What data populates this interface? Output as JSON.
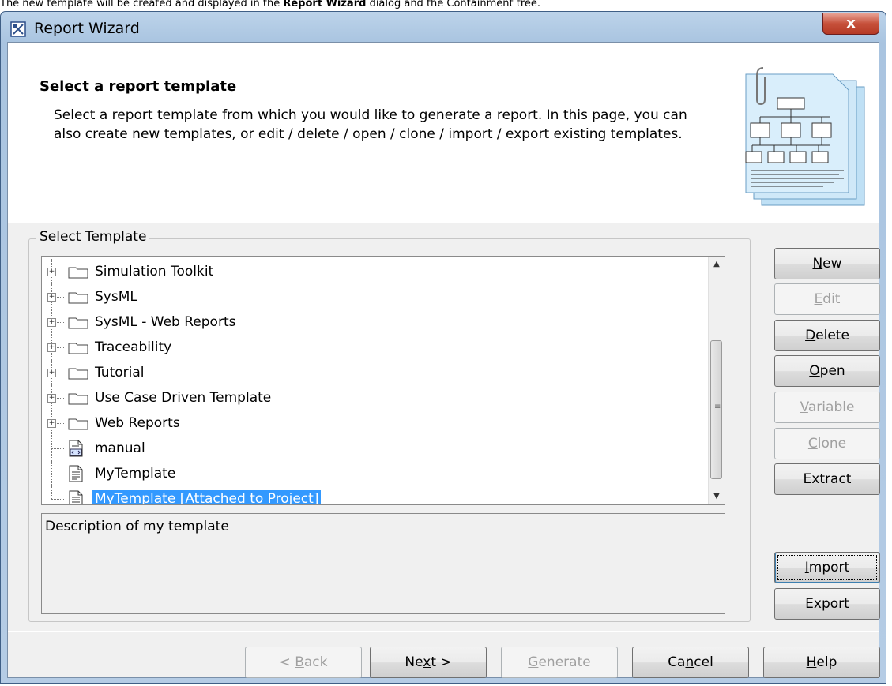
{
  "caption": {
    "pre": "The new template will be created and displayed in the ",
    "bold1": "Report Wizard",
    "mid": " dialog and the Containment tree."
  },
  "window": {
    "title": "Report Wizard",
    "close_label": "x"
  },
  "header": {
    "title": "Select a report template",
    "description": "Select a report template from which you would like to generate a report. In this page, you can also create new templates, or edit / delete / open / clone / import / export existing templates."
  },
  "template_group": {
    "label": "Select Template",
    "items": [
      {
        "label": "Simulation Toolkit",
        "type": "folder"
      },
      {
        "label": "SysML",
        "type": "folder"
      },
      {
        "label": "SysML - Web Reports",
        "type": "folder"
      },
      {
        "label": "Traceability",
        "type": "folder"
      },
      {
        "label": "Tutorial",
        "type": "folder"
      },
      {
        "label": "Use Case Driven Template",
        "type": "folder"
      },
      {
        "label": "Web Reports",
        "type": "folder"
      },
      {
        "label": "manual",
        "type": "xml-file"
      },
      {
        "label": "MyTemplate",
        "type": "file"
      },
      {
        "label": "MyTemplate [Attached to Project]",
        "type": "file",
        "selected": true
      }
    ],
    "description": "Description of my template"
  },
  "side_buttons": {
    "new": {
      "pre": "",
      "key": "N",
      "post": "ew"
    },
    "edit": {
      "pre": "",
      "key": "E",
      "post": "dit"
    },
    "delete": {
      "pre": "",
      "key": "D",
      "post": "elete"
    },
    "open": {
      "pre": "",
      "key": "O",
      "post": "pen"
    },
    "variable": {
      "pre": "",
      "key": "V",
      "post": "ariable"
    },
    "clone": {
      "pre": "",
      "key": "C",
      "post": "lone"
    },
    "extract": {
      "pre": "Extract",
      "key": "",
      "post": ""
    },
    "import": {
      "pre": "",
      "key": "I",
      "post": "mport"
    },
    "export": {
      "pre": "E",
      "key": "x",
      "post": "port"
    }
  },
  "footer_buttons": {
    "back": {
      "pre": "< ",
      "key": "B",
      "post": "ack"
    },
    "next": {
      "pre": "Ne",
      "key": "x",
      "post": "t >"
    },
    "generate": {
      "pre": "",
      "key": "G",
      "post": "enerate"
    },
    "cancel": {
      "pre": "Ca",
      "key": "n",
      "post": "cel"
    },
    "help": {
      "pre": "",
      "key": "H",
      "post": "elp"
    }
  },
  "colors": {
    "selection": "#3399ff",
    "title_bar": "#a9c4e0",
    "close_button": "#c6503b"
  },
  "icons": {
    "title": "report-wizard-icon",
    "folder": "folder-icon",
    "file": "document-icon",
    "xml": "xml-document-icon",
    "header_art": "report-template-illustration"
  }
}
